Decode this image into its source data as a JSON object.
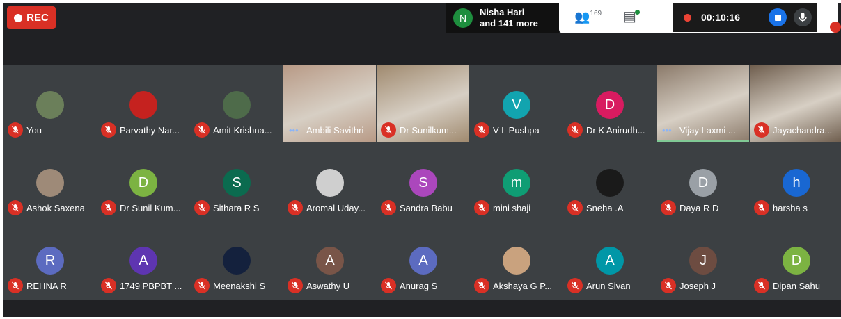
{
  "rec_label": "REC",
  "presence": {
    "initial": "N",
    "line1": "Nisha Hari",
    "line2": "and 141 more"
  },
  "toolbar": {
    "people_count": "169"
  },
  "timer": "00:10:16",
  "colors": {
    "rec": "#d93025",
    "bg": "#202124",
    "tile": "#3c4043",
    "accent": "#1a73e8",
    "active": "#81c995"
  },
  "participants": [
    {
      "name": "You",
      "initial": "",
      "color": "#6b7f5a",
      "type": "photo"
    },
    {
      "name": "Parvathy Nar...",
      "initial": "",
      "color": "#c5221f",
      "type": "photo"
    },
    {
      "name": "Amit Krishna...",
      "initial": "",
      "color": "#4e6b4a",
      "type": "photo"
    },
    {
      "name": "Ambili Savithri",
      "initial": "",
      "color": "#b89a86",
      "type": "video",
      "speaking": true
    },
    {
      "name": "Dr Sunilkum...",
      "initial": "",
      "color": "#a08a6f",
      "type": "video"
    },
    {
      "name": "V L Pushpa",
      "initial": "V",
      "color": "#12a4af",
      "type": "letter"
    },
    {
      "name": "Dr K Anirudh...",
      "initial": "D",
      "color": "#d81b60",
      "type": "letter"
    },
    {
      "name": "Vijay Laxmi ...",
      "initial": "",
      "color": "#8b7a6a",
      "type": "video",
      "speaking": true,
      "active": true
    },
    {
      "name": "Jayachandra...",
      "initial": "",
      "color": "#6f5e4e",
      "type": "video"
    },
    {
      "name": "Ashok Saxena",
      "initial": "",
      "color": "#9e8a78",
      "type": "photo"
    },
    {
      "name": "Dr Sunil Kum...",
      "initial": "D",
      "color": "#7cb342",
      "type": "letter"
    },
    {
      "name": "Sithara R S",
      "initial": "S",
      "color": "#0b6b4f",
      "type": "letter"
    },
    {
      "name": "Aromal Uday...",
      "initial": "",
      "color": "#cfcfcf",
      "type": "photo"
    },
    {
      "name": "Sandra Babu",
      "initial": "S",
      "color": "#ab47bc",
      "type": "letter"
    },
    {
      "name": "mini shaji",
      "initial": "m",
      "color": "#0f9d74",
      "type": "letter"
    },
    {
      "name": "Sneha .A",
      "initial": "",
      "color": "#1a1a1a",
      "type": "photo"
    },
    {
      "name": "Daya R D",
      "initial": "D",
      "color": "#9aa0a6",
      "type": "letter"
    },
    {
      "name": "harsha s",
      "initial": "h",
      "color": "#1967d2",
      "type": "letter"
    },
    {
      "name": "REHNA R",
      "initial": "R",
      "color": "#5c6bc0",
      "type": "letter"
    },
    {
      "name": "1749 PBPBT ...",
      "initial": "A",
      "color": "#5e35b1",
      "type": "letter"
    },
    {
      "name": "Meenakshi S",
      "initial": "",
      "color": "#14213d",
      "type": "photo"
    },
    {
      "name": "Aswathy U",
      "initial": "A",
      "color": "#795548",
      "type": "letter"
    },
    {
      "name": "Anurag S",
      "initial": "A",
      "color": "#5c6bc0",
      "type": "letter"
    },
    {
      "name": "Akshaya G P...",
      "initial": "",
      "color": "#c9a27e",
      "type": "photo"
    },
    {
      "name": "Arun Sivan",
      "initial": "A",
      "color": "#0097a7",
      "type": "letter"
    },
    {
      "name": "Joseph J",
      "initial": "J",
      "color": "#6d4c41",
      "type": "letter"
    },
    {
      "name": "Dipan Sahu",
      "initial": "D",
      "color": "#7cb342",
      "type": "letter"
    }
  ]
}
